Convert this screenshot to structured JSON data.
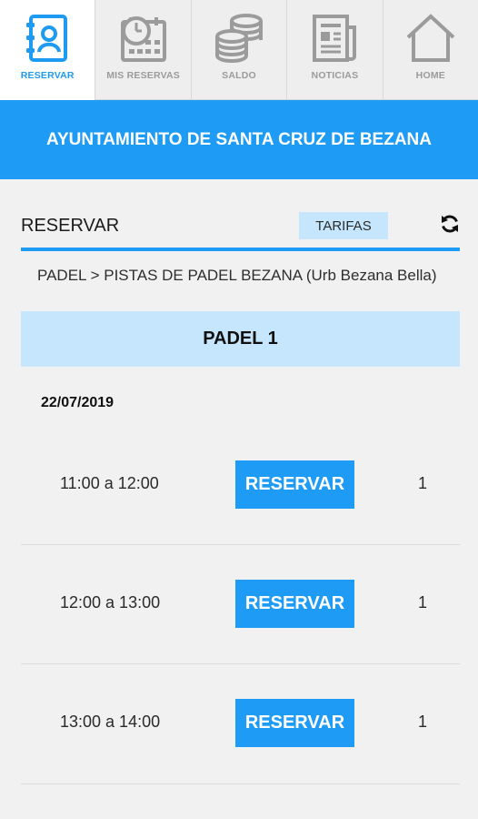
{
  "tabs": [
    {
      "label": "RESERVAR",
      "icon": "contact-book-icon",
      "active": true
    },
    {
      "label": "MIS RESERVAS",
      "icon": "calendar-clock-icon",
      "active": false
    },
    {
      "label": "SALDO",
      "icon": "coins-stack-icon",
      "active": false
    },
    {
      "label": "NOTICIAS",
      "icon": "newspaper-icon",
      "active": false
    },
    {
      "label": "HOME",
      "icon": "home-icon",
      "active": false
    }
  ],
  "banner": {
    "title": "AYUNTAMIENTO DE SANTA CRUZ DE BEZANA"
  },
  "section": {
    "title": "RESERVAR",
    "tarifas_label": "TARIFAS",
    "refresh_icon": "refresh-icon"
  },
  "breadcrumb": "PADEL > PISTAS DE PADEL BEZANA (Urb Bezana Bella)",
  "court": {
    "name": "PADEL 1"
  },
  "date": "22/07/2019",
  "slots": [
    {
      "time": "11:00 a 12:00",
      "button_label": "RESERVAR",
      "count": "1"
    },
    {
      "time": "12:00 a 13:00",
      "button_label": "RESERVAR",
      "count": "1"
    },
    {
      "time": "13:00 a 14:00",
      "button_label": "RESERVAR",
      "count": "1"
    }
  ],
  "colors": {
    "accent": "#1e9bf5",
    "accent_light": "#c5e6fc",
    "inactive_icon": "#9b9b9b",
    "background": "#f1f1f1"
  }
}
